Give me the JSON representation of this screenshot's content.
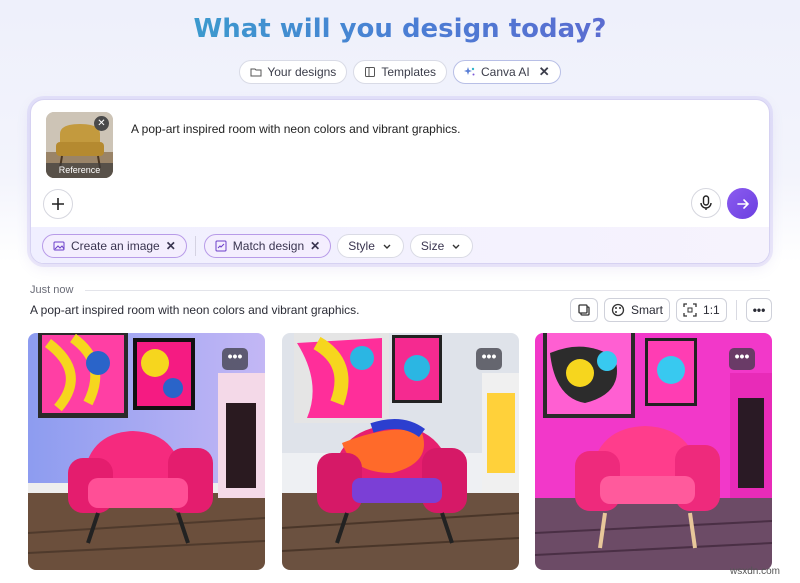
{
  "header": {
    "title": "What will you design today?"
  },
  "tabs": [
    {
      "label": "Your designs",
      "icon": "folder-icon"
    },
    {
      "label": "Templates",
      "icon": "template-icon"
    },
    {
      "label": "Canva AI",
      "icon": "sparkle-icon",
      "active": true,
      "close": "✕"
    }
  ],
  "prompt": {
    "reference_label": "Reference",
    "reference_close": "✕",
    "text": "A pop-art inspired room with neon colors and vibrant graphics.",
    "options": [
      {
        "label": "Create an image",
        "selected": true,
        "icon": "image-icon",
        "close": "✕"
      },
      {
        "label": "Match design",
        "selected": true,
        "icon": "design-icon",
        "close": "✕"
      },
      {
        "label": "Style",
        "selected": false,
        "dropdown": true
      },
      {
        "label": "Size",
        "selected": false,
        "dropdown": true
      }
    ]
  },
  "result": {
    "timestamp": "Just now",
    "prompt": "A pop-art inspired room with neon colors and vibrant graphics.",
    "toolbar": {
      "copy_icon": "copy-icon",
      "smart_label": "Smart",
      "ratio_label": "1:1",
      "more": "•••"
    },
    "images": [
      {
        "alt": "pink armchair pop-art room 1",
        "more": "•••"
      },
      {
        "alt": "pink armchair pop-art room 2",
        "more": "•••"
      },
      {
        "alt": "pink armchair pop-art room 3",
        "more": "•••"
      }
    ]
  },
  "watermark": "wsxdn.com",
  "colors": {
    "accent": "#7b4ee6",
    "brand_gradient_start": "#2fb3c8",
    "brand_gradient_end": "#6a5acd"
  }
}
